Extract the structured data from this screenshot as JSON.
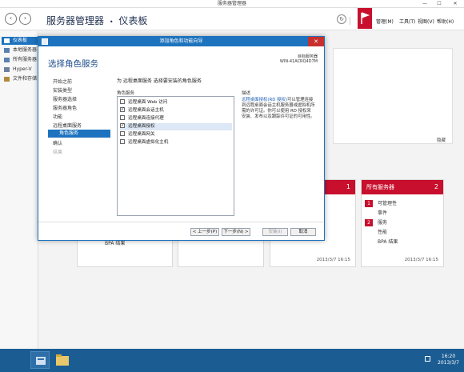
{
  "window": {
    "title": "服务器管理器",
    "minimize": "—",
    "maximize": "☐",
    "close": "✕"
  },
  "header": {
    "breadcrumb_app": "服务器管理器",
    "breadcrumb_sep": "•",
    "breadcrumb_page": "仪表板",
    "menu": [
      "管理(M)",
      "工具(T)",
      "视图(V)",
      "帮助(H)"
    ]
  },
  "sidebar": {
    "items": [
      "仪表板",
      "本地服务器",
      "所有服务器",
      "Hyper-V",
      "文件和存储"
    ]
  },
  "background": {
    "hide_label": "隐藏",
    "tile_left": {
      "count": "1"
    },
    "tile_all": {
      "title": "所有服务器",
      "count": "2",
      "rows": [
        {
          "badge": "1",
          "label": "可管理性"
        },
        {
          "badge": "",
          "label": "事件"
        },
        {
          "badge": "2",
          "label": "服务"
        },
        {
          "badge": "",
          "label": "性能"
        },
        {
          "badge": "",
          "label": "BPA 结果"
        }
      ],
      "timestamp": "2013/3/7 16:15"
    },
    "tile_mid_timestamp": "2013/3/7 16:15",
    "tile_bpa_left": "BPA 结果"
  },
  "dialog": {
    "title": "添加角色和功能向导",
    "heading": "选择角色服务",
    "target_label": "目标服务器",
    "target_value": "WIN-41ACRQ4D7M",
    "steps": [
      {
        "label": "开始之前",
        "state": "normal"
      },
      {
        "label": "安装类型",
        "state": "normal"
      },
      {
        "label": "服务器选择",
        "state": "normal"
      },
      {
        "label": "服务器角色",
        "state": "normal"
      },
      {
        "label": "功能",
        "state": "normal"
      },
      {
        "label": "远程桌面服务",
        "state": "normal"
      },
      {
        "label": "角色服务",
        "state": "active"
      },
      {
        "label": "确认",
        "state": "normal"
      },
      {
        "label": "结果",
        "state": "dim"
      }
    ],
    "intro": "为 远程桌面服务 选择要安装的角色服务",
    "services_label": "角色服务",
    "services": [
      {
        "label": "远程桌面 Web 访问",
        "checked": false,
        "selected": false
      },
      {
        "label": "远程桌面会话主机",
        "checked": true,
        "selected": false
      },
      {
        "label": "远程桌面连接代理",
        "checked": false,
        "selected": false
      },
      {
        "label": "远程桌面授权",
        "checked": true,
        "selected": true
      },
      {
        "label": "远程桌面网关",
        "checked": false,
        "selected": false
      },
      {
        "label": "远程桌面虚拟化主机",
        "checked": false,
        "selected": false
      }
    ],
    "desc_label": "描述",
    "desc_link": "远程桌面授权(RD 授权)",
    "desc_text": "可以管理连接到远程桌面会话主机服务器或虚拟机所需的许可证。你可以使用 RD 授权来安装、发布以及跟踪许可证的可用性。",
    "buttons": {
      "prev": "< 上一步(P)",
      "next": "下一步(N) >",
      "install": "安装(I)",
      "cancel": "取消"
    }
  },
  "taskbar": {
    "time": "16:20",
    "date": "2013/3/7"
  },
  "colors": {
    "accent": "#1e73be",
    "alert": "#c8102e",
    "taskbar": "#1b5c93"
  }
}
